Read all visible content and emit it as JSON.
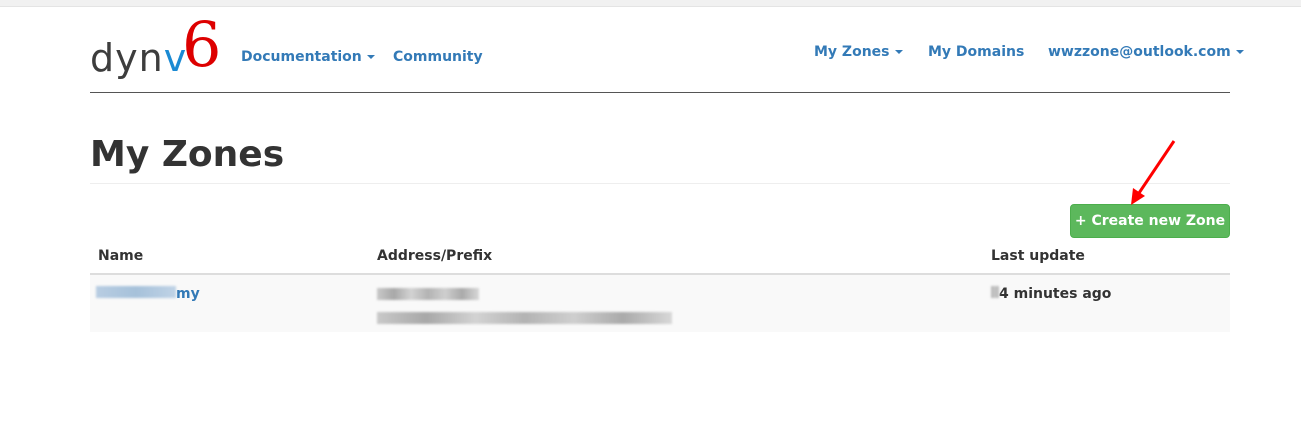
{
  "header": {
    "logo_text": "dynv6",
    "logo_parts": [
      "dyn",
      "v",
      "6"
    ],
    "nav_left": [
      {
        "label": "Documentation",
        "dropdown": true
      },
      {
        "label": "Community",
        "dropdown": false
      }
    ],
    "nav_right": [
      {
        "label": "My Zones",
        "dropdown": true
      },
      {
        "label": "My Domains",
        "dropdown": false
      },
      {
        "label": "wwzzone@outlook.com",
        "dropdown": true
      }
    ]
  },
  "page": {
    "title": "My Zones",
    "create_button": "+ Create new Zone"
  },
  "table": {
    "headers": [
      "Name",
      "Address/Prefix",
      "Last update"
    ],
    "rows": [
      {
        "name_visible": "my",
        "last_update": "4 minutes ago"
      }
    ]
  },
  "colors": {
    "link": "#337ab7",
    "button": "#5cb85c",
    "annotation_arrow": "#ff0000"
  }
}
